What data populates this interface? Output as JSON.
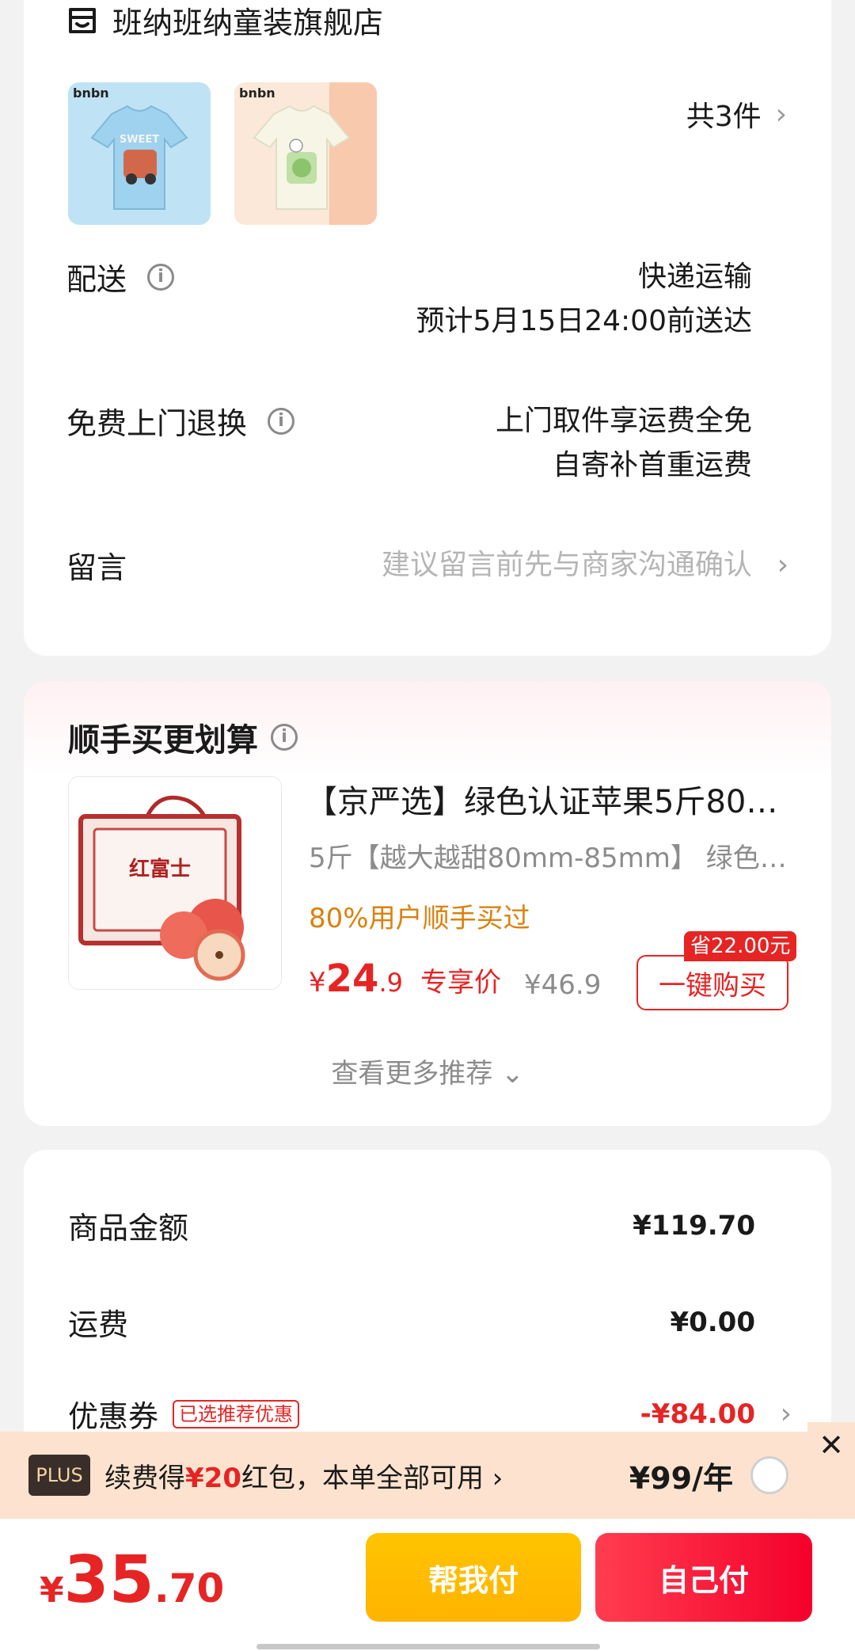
{
  "shop": {
    "name": "班纳班纳童装旗舰店",
    "item_count_label": "共3件",
    "thumbnails": [
      {
        "brand": "bnbn",
        "color": "#bfe3f4"
      },
      {
        "brand": "bnbn",
        "color": "#fbe8d9"
      }
    ]
  },
  "delivery": {
    "label": "配送",
    "method": "快递运输",
    "eta": "预计5月15日24:00前送达"
  },
  "return_service": {
    "label": "免费上门退换",
    "line1": "上门取件享运费全免",
    "line2": "自寄补首重运费"
  },
  "note": {
    "label": "留言",
    "placeholder": "建议留言前先与商家沟通确认"
  },
  "recommend": {
    "title": "顺手买更划算",
    "product": {
      "name": "【京严选】绿色认证苹果5斤80…",
      "spec": "5斤【越大越甜80mm-85mm】 绿色…",
      "bought": "80%用户顺手买过",
      "price_yen": "¥",
      "price_int": "24",
      "price_dec": ".9",
      "price_tag": "专享价",
      "original_price": "¥46.9",
      "save_badge": "省22.00元",
      "buy_label": "一键购买",
      "box_text": "红富士"
    },
    "more_label": "查看更多推荐"
  },
  "amounts": {
    "goods_label": "商品金额",
    "goods_value": "¥119.70",
    "shipping_label": "运费",
    "shipping_value": "¥0.00",
    "coupon_label": "优惠券",
    "coupon_tag": "已选推荐优惠",
    "coupon_value": "-¥84.00"
  },
  "plus": {
    "badge": "PLUS",
    "text_pre": "续费得",
    "text_hl": "¥20",
    "text_post": "红包，本单全部可用",
    "price": "¥99/年"
  },
  "bottom": {
    "total_yen": "¥",
    "total_int": "35",
    "total_dec": ".70",
    "help_pay": "帮我付",
    "self_pay": "自己付"
  }
}
